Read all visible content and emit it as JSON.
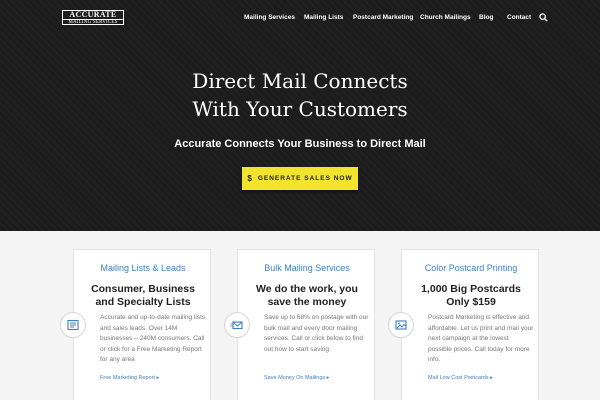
{
  "logo": {
    "line1": "ACCURATE",
    "line2": "MAILING SERVICES"
  },
  "nav": {
    "items": [
      {
        "label": "Mailing Services"
      },
      {
        "label": "Mailing Lists"
      },
      {
        "label": "Postcard Marketing"
      },
      {
        "label": "Church Mailings"
      },
      {
        "label": "Blog"
      },
      {
        "label": "Contact"
      }
    ],
    "search_icon": "search-icon"
  },
  "hero": {
    "title_line1": "Direct Mail Connects",
    "title_line2": "With Your Customers",
    "subtitle": "Accurate Connects Your Business to Direct Mail",
    "cta_icon": "$",
    "cta_label": "GENERATE SALES NOW"
  },
  "colors": {
    "accent_yellow": "#f2e42c",
    "link_blue": "#3f7fbf",
    "hero_bg": "#1c1c1c"
  },
  "cards": [
    {
      "heading": "Mailing Lists & Leads",
      "title_line1": "Consumer, Business",
      "title_line2": "and Specialty Lists",
      "body": "Accurate and up-to-date mailing lists and sales leads. Over 14M businesses – 240M consumers. Call or click for a Free Marketing Report for any area",
      "link": "Free Marketing Report ▸",
      "icon": "newspaper-icon"
    },
    {
      "heading": "Bulk Mailing Services",
      "title_line1": "We do the work, you",
      "title_line2": "save the money",
      "body": "Save up to 68% on postage with our bulk mail and every door mailing services. Call or click below to find out how to start saving.",
      "link": "Save Money On Mailings ▸",
      "icon": "envelope-icon"
    },
    {
      "heading": "Color Postcard Printing",
      "title_line1": "1,000 Big Postcards",
      "title_line2": "Only $159",
      "body": "Postcard Marketing is effective and affordable. Let us print and mail your next campaign at the lowest possible prices. Call today for more info.",
      "link": "Mail Low Cost Postcards ▸",
      "icon": "image-icon"
    }
  ]
}
